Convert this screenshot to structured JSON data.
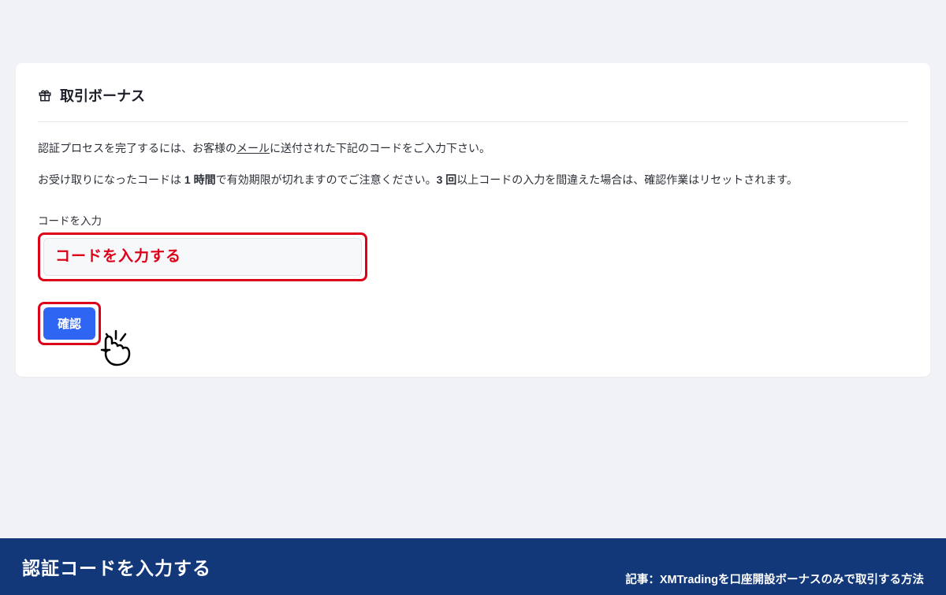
{
  "card": {
    "title": "取引ボーナス",
    "instruction1_prefix": "認証プロセスを完了するには、お客様の",
    "instruction1_underlined": "メール",
    "instruction1_suffix": "に送付された下記のコードをご入力下さい。",
    "instruction2_p1": "お受け取りになったコードは ",
    "instruction2_b1": "1 時間",
    "instruction2_p2": "で有効期限が切れますのでご注意ください。",
    "instruction2_b2": "3 回",
    "instruction2_p3": "以上コードの入力を間違えた場合は、確認作業はリセットされます。",
    "input_label": "コードを入力",
    "input_placeholder": "コードを入力する",
    "confirm_label": "確認"
  },
  "footer": {
    "title": "認証コードを入力する",
    "subtitle": "記事：XMTradingを口座開設ボーナスのみで取引する方法"
  }
}
